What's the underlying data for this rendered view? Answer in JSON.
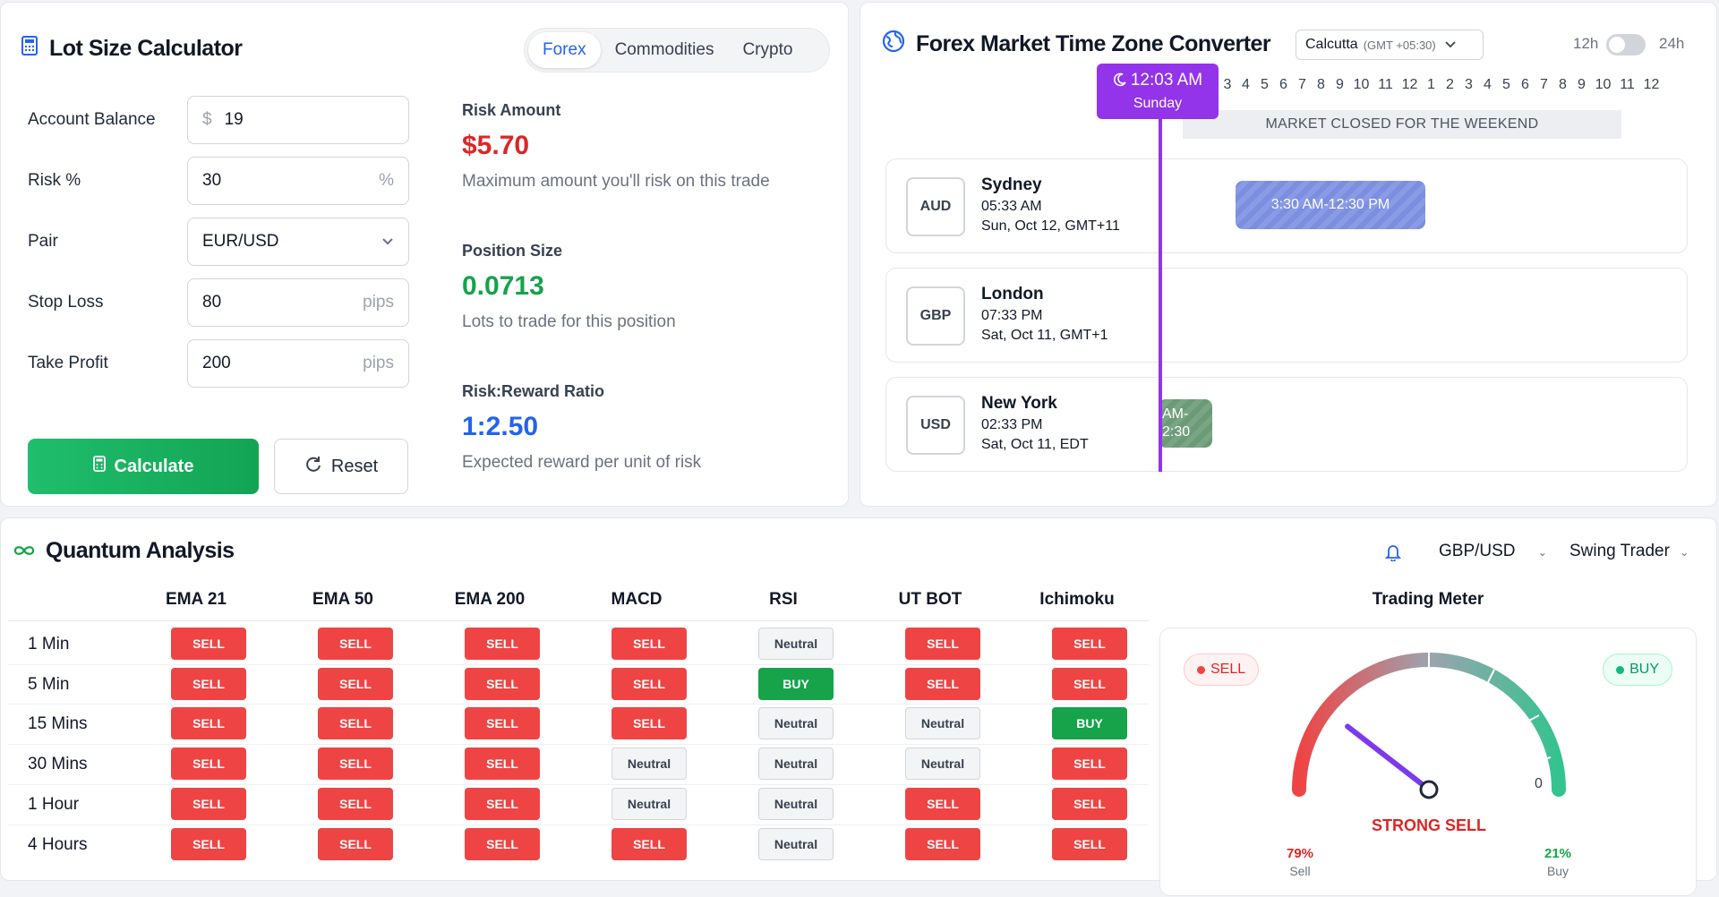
{
  "lot": {
    "title": "Lot Size Calculator",
    "tabs": [
      "Forex",
      "Commodities",
      "Crypto"
    ],
    "active_tab": "Forex",
    "fields": {
      "balance": {
        "label": "Account Balance",
        "prefix": "$",
        "value": "19"
      },
      "risk": {
        "label": "Risk %",
        "value": "30",
        "suffix": "%"
      },
      "pair": {
        "label": "Pair",
        "value": "EUR/USD"
      },
      "stop": {
        "label": "Stop Loss",
        "value": "80",
        "suffix": "pips"
      },
      "take": {
        "label": "Take Profit",
        "value": "200",
        "suffix": "pips"
      }
    },
    "calculate_label": "Calculate",
    "reset_label": "Reset",
    "results": {
      "risk": {
        "title": "Risk Amount",
        "value": "$5.70",
        "desc": "Maximum amount you'll risk on this trade",
        "color": "#dc2626"
      },
      "pos": {
        "title": "Position Size",
        "value": "0.0713",
        "desc": "Lots to trade for this position",
        "color": "#16a34a"
      },
      "rr": {
        "title": "Risk:Reward Ratio",
        "value": "1:2.50",
        "desc": "Expected reward per unit of risk",
        "color": "#2563eb"
      }
    }
  },
  "fx": {
    "title": "Forex Market Time Zone Converter",
    "timezone": "Calcutta",
    "timezone_gmt": "(GMT +05:30)",
    "h12": "12h",
    "h24": "24h",
    "hours": [
      "3",
      "4",
      "5",
      "6",
      "7",
      "8",
      "9",
      "10",
      "11",
      "12",
      "1",
      "2",
      "3",
      "4",
      "5",
      "6",
      "7",
      "8",
      "9",
      "10",
      "11",
      "12"
    ],
    "closed_msg": "MARKET CLOSED FOR THE WEEKEND",
    "now_time": "12:03 AM",
    "now_day": "Sunday",
    "markets": [
      {
        "code": "AUD",
        "name": "Sydney",
        "time": "05:33 AM",
        "date": "Sun, Oct 12, GMT+11",
        "session": "3:30 AM-12:30 PM"
      },
      {
        "code": "GBP",
        "name": "London",
        "time": "07:33 PM",
        "date": "Sat, Oct 11, GMT+1",
        "session": ""
      },
      {
        "code": "USD",
        "name": "New York",
        "time": "02:33 PM",
        "date": "Sat, Oct 11, EDT",
        "session": "AM-\n2:30"
      }
    ],
    "colors": {
      "sydney": "#7b8ee0",
      "newyork": "#6b9a77",
      "now": "#9333ea"
    }
  },
  "qa": {
    "title": "Quantum Analysis",
    "pair": "GBP/USD",
    "profile": "Swing Trader",
    "columns": [
      "EMA 21",
      "EMA 50",
      "EMA 200",
      "MACD",
      "RSI",
      "UT BOT",
      "Ichimoku"
    ],
    "rows": [
      {
        "tf": "1 Min",
        "signals": [
          "SELL",
          "SELL",
          "SELL",
          "SELL",
          "Neutral",
          "SELL",
          "SELL"
        ]
      },
      {
        "tf": "5 Min",
        "signals": [
          "SELL",
          "SELL",
          "SELL",
          "SELL",
          "BUY",
          "SELL",
          "SELL"
        ]
      },
      {
        "tf": "15 Mins",
        "signals": [
          "SELL",
          "SELL",
          "SELL",
          "SELL",
          "Neutral",
          "Neutral",
          "BUY"
        ]
      },
      {
        "tf": "30 Mins",
        "signals": [
          "SELL",
          "SELL",
          "SELL",
          "Neutral",
          "Neutral",
          "Neutral",
          "SELL"
        ]
      },
      {
        "tf": "1 Hour",
        "signals": [
          "SELL",
          "SELL",
          "SELL",
          "Neutral",
          "Neutral",
          "SELL",
          "SELL"
        ]
      },
      {
        "tf": "4 Hours",
        "signals": [
          "SELL",
          "SELL",
          "SELL",
          "SELL",
          "Neutral",
          "SELL",
          "SELL"
        ]
      }
    ],
    "meter": {
      "title": "Trading Meter",
      "sell_badge": "SELL",
      "buy_badge": "BUY",
      "zero_label": "0",
      "verdict": "STRONG SELL",
      "sell_pct": "79%",
      "buy_pct": "21%",
      "sell_label": "Sell",
      "buy_label": "Buy",
      "sell_fraction": 0.79
    }
  }
}
